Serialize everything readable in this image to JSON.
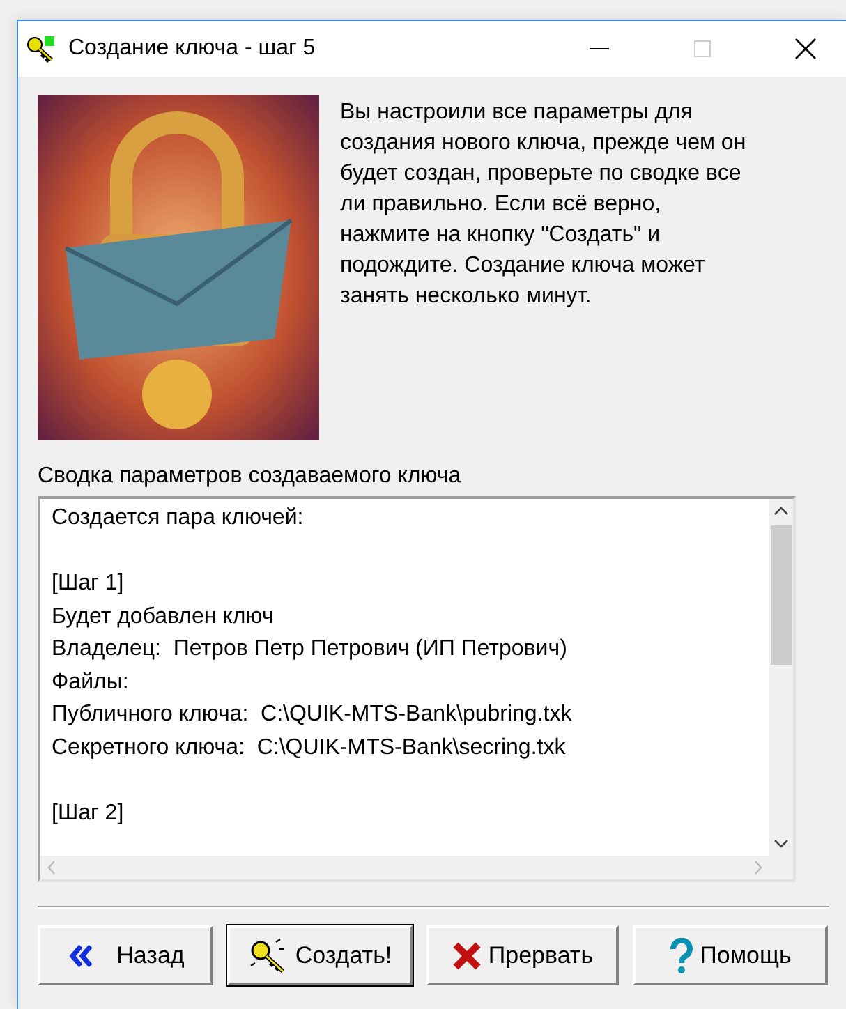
{
  "window": {
    "title": "Создание ключа - шаг 5"
  },
  "intro": "Вы настроили все параметры для создания нового ключа, прежде чем он будет создан, проверьте по сводке все ли правильно. Если всё верно, нажмите на кнопку \"Создать\" и подождите. Создание ключа может занять несколько минут.",
  "summary": {
    "label": "Сводка параметров создаваемого ключа",
    "paragraphs": [
      [
        "Создается пара ключей:"
      ],
      [
        "[Шаг 1]",
        "Будет добавлен ключ",
        "Владелец:  Петров Петр Петрович (ИП Петрович)",
        "Файлы:",
        "Публичного ключа:  C:\\QUIK-MTS-Bank\\pubring.txk",
        "Секретного ключа:  C:\\QUIK-MTS-Bank\\secring.txk"
      ],
      [
        "[Шаг 2]"
      ]
    ]
  },
  "buttons": [
    {
      "kind": "back",
      "label": "Назад",
      "default": false
    },
    {
      "kind": "create",
      "label": "Создать!",
      "default": true
    },
    {
      "kind": "abort",
      "label": "Прервать",
      "default": false
    },
    {
      "kind": "help",
      "label": "Помощь",
      "default": false
    }
  ]
}
